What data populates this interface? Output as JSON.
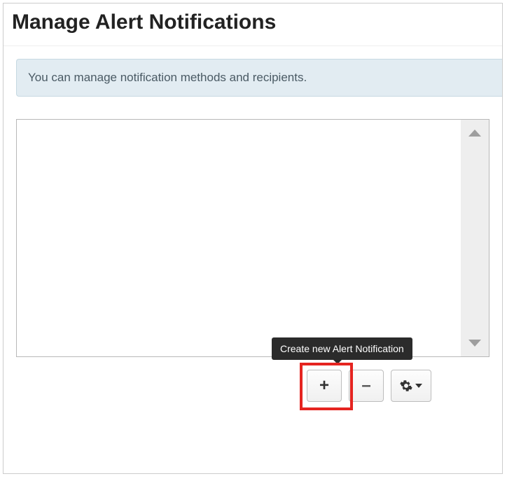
{
  "header": {
    "title": "Manage Alert Notifications"
  },
  "banner": {
    "text": "You can manage notification methods and recipients."
  },
  "tooltip": {
    "text": "Create new Alert Notification"
  },
  "toolbar": {
    "add_label": "+",
    "remove_label": "–"
  }
}
